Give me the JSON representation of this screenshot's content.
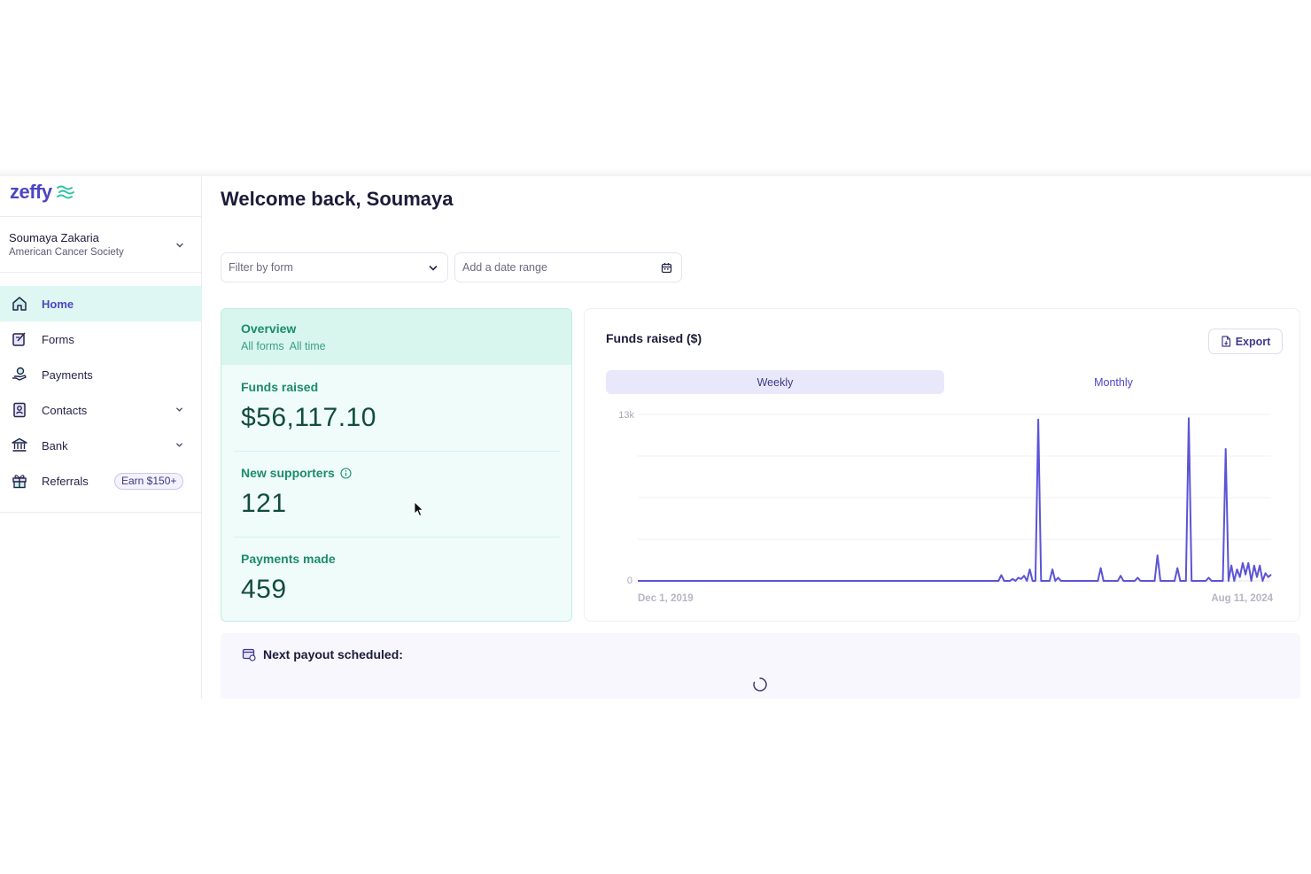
{
  "brand": {
    "logo_text": "zeffy",
    "accent": "#4d45c4",
    "mint": "#1c8c6a"
  },
  "sidebar": {
    "user_name": "Soumaya Zakaria",
    "user_org": "American Cancer Society",
    "items": [
      {
        "label": "Home",
        "icon": "home-icon",
        "active": true
      },
      {
        "label": "Forms",
        "icon": "forms-icon"
      },
      {
        "label": "Payments",
        "icon": "payments-icon"
      },
      {
        "label": "Contacts",
        "icon": "contacts-icon",
        "expandable": true
      },
      {
        "label": "Bank",
        "icon": "bank-icon",
        "expandable": true
      },
      {
        "label": "Referrals",
        "icon": "gift-icon",
        "badge": "Earn $150+"
      }
    ]
  },
  "main": {
    "welcome": "Welcome back, Soumaya",
    "filters": {
      "form_placeholder": "Filter by form",
      "date_placeholder": "Add a date range"
    },
    "overview": {
      "title": "Overview",
      "scope_forms": "All forms",
      "scope_time": "All time",
      "funds_label": "Funds raised",
      "funds_value": "$56,117.10",
      "supporters_label": "New supporters",
      "supporters_value": "121",
      "payments_label": "Payments made",
      "payments_value": "459"
    },
    "chart_panel": {
      "title": "Funds raised ($)",
      "export_label": "Export",
      "tabs": [
        "Weekly",
        "Monthly"
      ],
      "active_tab": "Weekly"
    },
    "payout": {
      "title": "Next payout scheduled:"
    }
  },
  "chart_data": {
    "type": "line",
    "ylabel": "",
    "yticks": [
      "13k",
      "0"
    ],
    "ylim": [
      0,
      13000
    ],
    "x_start_label": "Dec 1, 2019",
    "x_end_label": "Aug 11, 2024",
    "series_color": "#5b54d6",
    "grid": true,
    "values": [
      0,
      0,
      0,
      0,
      0,
      0,
      0,
      0,
      0,
      0,
      0,
      0,
      0,
      0,
      0,
      0,
      0,
      0,
      0,
      0,
      0,
      0,
      0,
      0,
      0,
      0,
      0,
      0,
      0,
      0,
      0,
      0,
      0,
      0,
      0,
      0,
      0,
      0,
      0,
      0,
      0,
      0,
      0,
      0,
      0,
      0,
      0,
      0,
      0,
      0,
      0,
      0,
      0,
      0,
      0,
      0,
      0,
      0,
      0,
      0,
      0,
      0,
      0,
      0,
      0,
      0,
      0,
      0,
      0,
      0,
      0,
      0,
      0,
      0,
      0,
      0,
      0,
      0,
      0,
      0,
      0,
      0,
      0,
      0,
      0,
      0,
      0,
      0,
      0,
      0,
      0,
      0,
      0,
      0,
      0,
      0,
      0,
      0,
      0,
      0,
      0,
      0,
      0,
      0,
      0,
      0,
      0,
      0,
      0,
      0,
      0,
      0,
      0,
      0,
      0,
      0,
      0,
      0,
      0,
      0,
      0,
      0,
      0,
      0,
      0,
      0,
      0,
      0,
      450,
      0,
      0,
      0,
      150,
      0,
      250,
      150,
      400,
      0,
      900,
      0,
      0,
      12600,
      0,
      0,
      0,
      0,
      900,
      0,
      250,
      0,
      0,
      0,
      0,
      0,
      0,
      0,
      0,
      0,
      0,
      0,
      0,
      0,
      0,
      1000,
      0,
      0,
      0,
      0,
      0,
      0,
      400,
      0,
      0,
      0,
      0,
      0,
      250,
      0,
      0,
      0,
      0,
      0,
      0,
      2000,
      0,
      0,
      0,
      0,
      0,
      0,
      1000,
      0,
      0,
      0,
      12700,
      0,
      0,
      0,
      0,
      0,
      0,
      250,
      0,
      0,
      0,
      0,
      0,
      10300,
      0,
      1200,
      0,
      900,
      300,
      1400,
      500,
      1400,
      0,
      1200,
      300,
      1200,
      0,
      600,
      300,
      500
    ]
  }
}
